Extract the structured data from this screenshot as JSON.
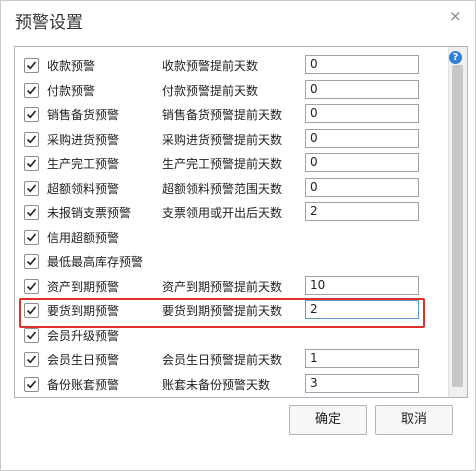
{
  "dialog": {
    "title": "预警设置",
    "close_glyph": "×",
    "help_glyph": "?"
  },
  "rows": [
    {
      "checked": true,
      "name": "收款预警",
      "setting_label": "收款预警提前天数",
      "value": "0"
    },
    {
      "checked": true,
      "name": "付款预警",
      "setting_label": "付款预警提前天数",
      "value": "0"
    },
    {
      "checked": true,
      "name": "销售备货预警",
      "setting_label": "销售备货预警提前天数",
      "value": "0"
    },
    {
      "checked": true,
      "name": "采购进货预警",
      "setting_label": "采购进货预警提前天数",
      "value": "0"
    },
    {
      "checked": true,
      "name": "生产完工预警",
      "setting_label": "生产完工预警提前天数",
      "value": "0"
    },
    {
      "checked": true,
      "name": "超额领料预警",
      "setting_label": "超额领料预警范围天数",
      "value": "0"
    },
    {
      "checked": true,
      "name": "未报销支票预警",
      "setting_label": "支票领用或开出后天数",
      "value": "2"
    },
    {
      "checked": true,
      "name": "信用超额预警",
      "setting_label": "",
      "value": null
    },
    {
      "checked": true,
      "name": "最低最高库存预警",
      "setting_label": "",
      "value": null
    },
    {
      "checked": true,
      "name": "资产到期预警",
      "setting_label": "资产到期预警提前天数",
      "value": "10"
    },
    {
      "checked": true,
      "name": "要货到期预警",
      "setting_label": "要货到期预警提前天数",
      "value": "2",
      "highlighted": true
    },
    {
      "checked": true,
      "name": "会员升级预警",
      "setting_label": "",
      "value": null
    },
    {
      "checked": true,
      "name": "会员生日预警",
      "setting_label": "会员生日预警提前天数",
      "value": "1"
    },
    {
      "checked": true,
      "name": "备份账套预警",
      "setting_label": "账套未备份预警天数",
      "value": "3"
    }
  ],
  "buttons": {
    "ok": "确定",
    "cancel": "取消"
  },
  "colors": {
    "highlight": "#e0302b",
    "help": "#2e7fd6"
  }
}
